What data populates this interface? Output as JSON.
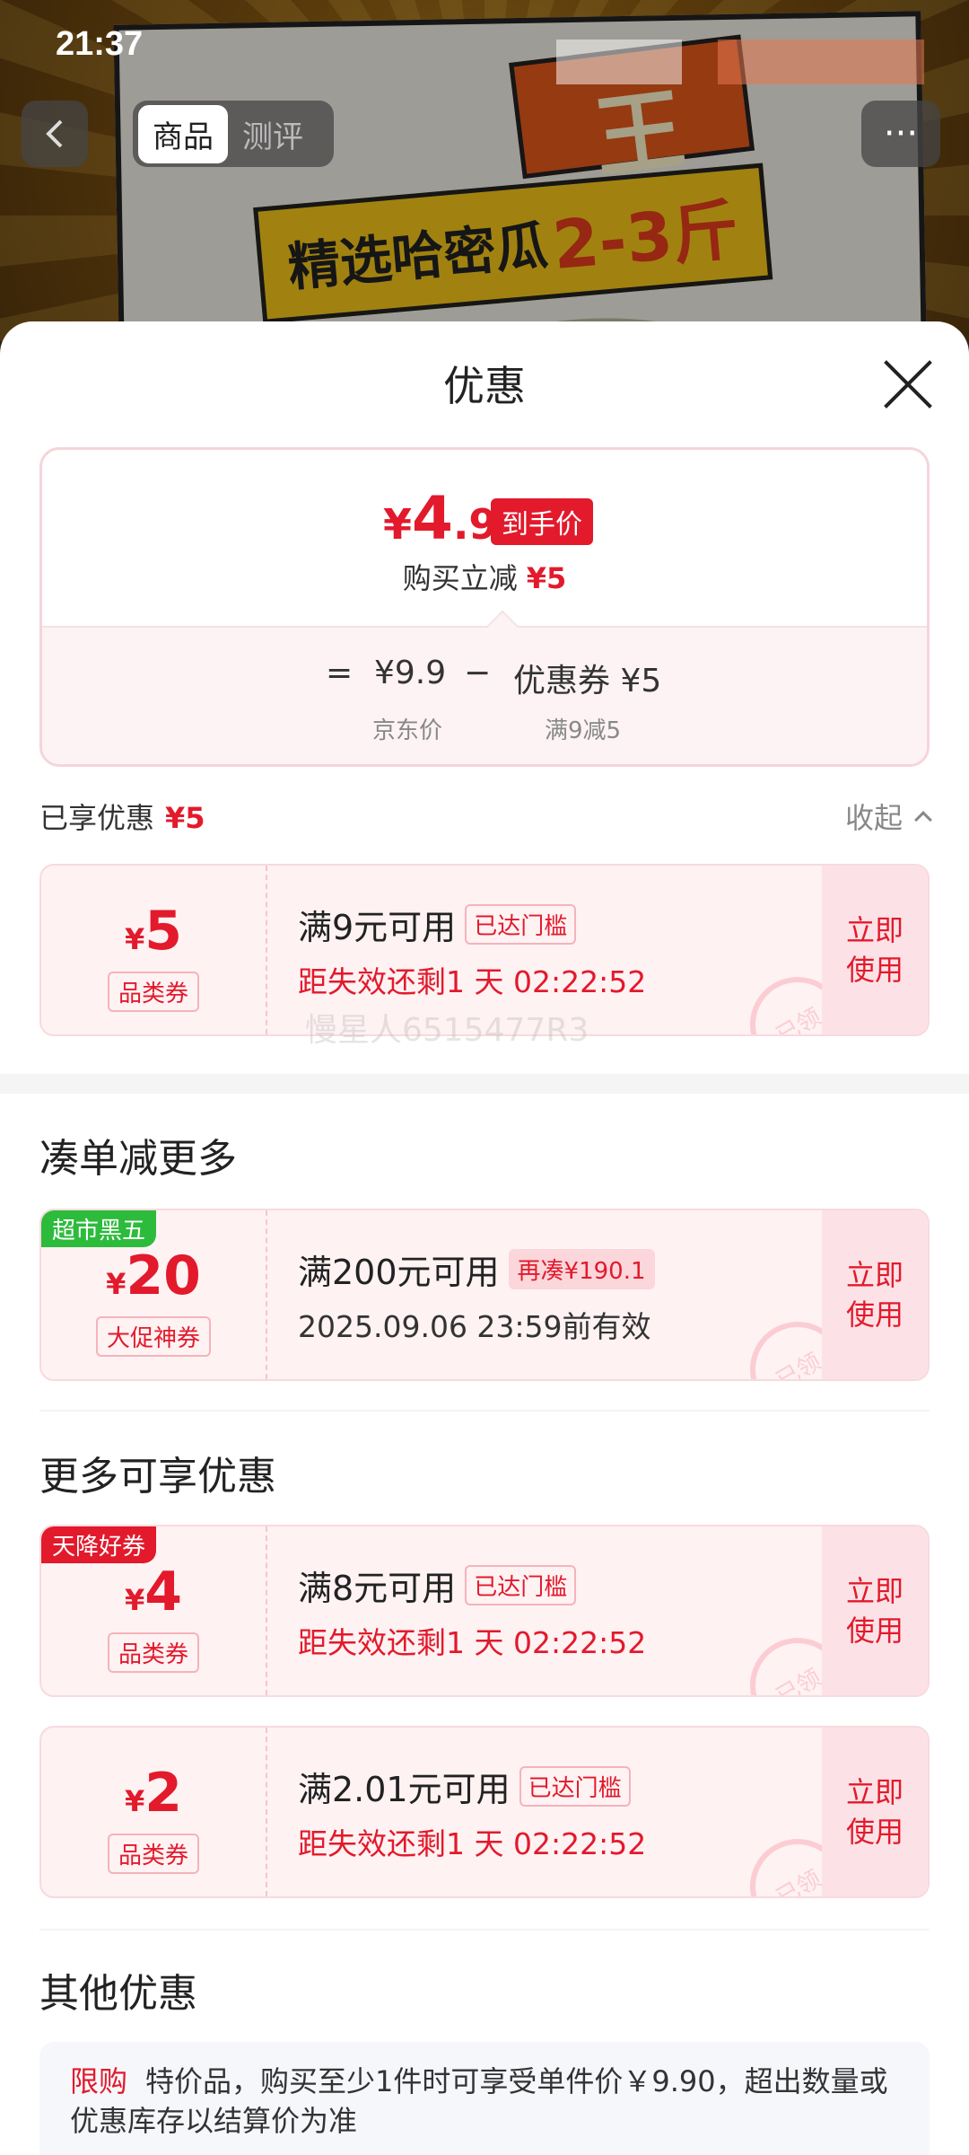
{
  "status_bar": {
    "time": "21:37"
  },
  "top_nav": {
    "tabs": [
      {
        "label": "商品",
        "active": true
      },
      {
        "label": "测评",
        "active": false
      }
    ]
  },
  "poster": {
    "title_text": "精选哈密瓜",
    "title_weight": "2-3斤",
    "badge_char": "王"
  },
  "sheet": {
    "title": "优惠",
    "summary": {
      "yen": "¥",
      "price_int": "4",
      "price_dec": ".9",
      "price_tag": "到手价",
      "reduce_label": "购买立减",
      "reduce_amount": "¥5",
      "eq": "=",
      "jd_price": "¥9.9",
      "minus": "−",
      "coupon_label": "优惠券 ¥5",
      "jd_price_label": "京东价",
      "coupon_rule": "满9减5"
    },
    "applied": {
      "label": "已享优惠",
      "amount": "¥5",
      "collapse_label": "收起"
    },
    "watermark": "慢星人6515477R3",
    "sections": {
      "bundle_title": "凑单减更多",
      "more_title": "更多可享优惠",
      "other_title": "其他优惠"
    },
    "coupons": [
      {
        "corner": "",
        "yen": "¥",
        "amount": "5",
        "type": "品类券",
        "condition": "满9元可用",
        "tag": "已达门槛",
        "time": "距失效还剩1 天 02:22:52",
        "action": "立即使用",
        "stamp": "已领"
      },
      {
        "corner": "超市黑五",
        "yen": "¥",
        "amount": "20",
        "type": "大促神券",
        "condition": "满200元可用",
        "tag": "再凑¥190.1",
        "time": "2025.09.06 23:59前有效",
        "action": "立即使用",
        "stamp": "已领"
      },
      {
        "corner": "天降好券",
        "yen": "¥",
        "amount": "4",
        "type": "品类券",
        "condition": "满8元可用",
        "tag": "已达门槛",
        "time": "距失效还剩1 天 02:22:52",
        "action": "立即使用",
        "stamp": "已领"
      },
      {
        "corner": "",
        "yen": "¥",
        "amount": "2",
        "type": "品类券",
        "condition": "满2.01元可用",
        "tag": "已达门槛",
        "time": "距失效还剩1 天 02:22:52",
        "action": "立即使用",
        "stamp": "已领"
      }
    ],
    "other": {
      "limit_label": "限购",
      "text": "特价品，购买至少1件时可享受单件价￥9.90，超出数量或优惠库存以结算价为准"
    }
  },
  "colors": {
    "accent": "#e21a2c",
    "corner_green": "#2dbb3c",
    "corner_red": "#e21a2c"
  }
}
